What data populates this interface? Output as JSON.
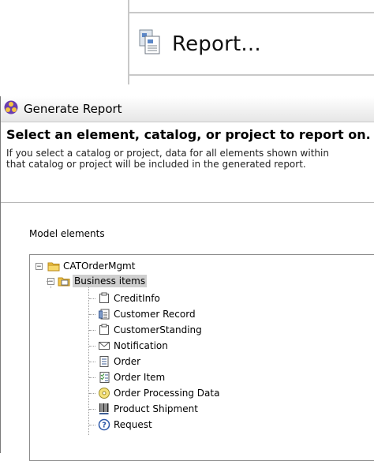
{
  "menu": {
    "report_label": "Report..."
  },
  "dialog": {
    "title": "Generate Report",
    "heading": "Select an element, catalog, or project to report on.",
    "description_line1": "If you select a catalog or project, data for all elements shown within",
    "description_line2": "that catalog or project will be included in the generated report.",
    "model_elements_label": "Model elements"
  },
  "tree": {
    "root": "CATOrderMgmt",
    "group": "Business items",
    "items": [
      {
        "label": "CreditInfo",
        "icon": "business-item-icon"
      },
      {
        "label": "Customer Record",
        "icon": "record-icon"
      },
      {
        "label": "CustomerStanding",
        "icon": "business-item-icon"
      },
      {
        "label": "Notification",
        "icon": "envelope-icon"
      },
      {
        "label": "Order",
        "icon": "document-icon"
      },
      {
        "label": "Order Item",
        "icon": "checklist-icon"
      },
      {
        "label": "Order Processing Data",
        "icon": "cd-icon"
      },
      {
        "label": "Product Shipment",
        "icon": "barcode-icon"
      },
      {
        "label": "Request",
        "icon": "question-icon"
      }
    ]
  },
  "colors": {
    "folder": "#f3c544",
    "selection": "#cfcfcf",
    "question": "#2b57a8"
  }
}
